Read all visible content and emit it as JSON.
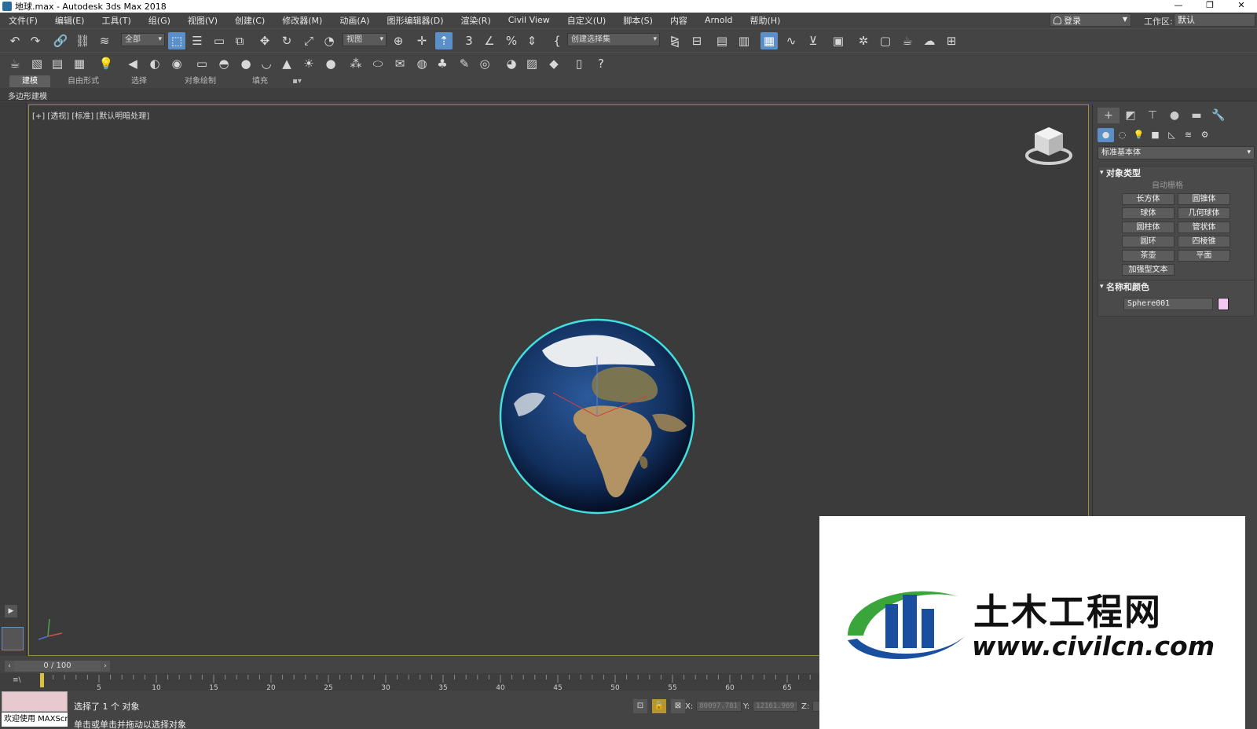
{
  "window": {
    "title": "地球.max - Autodesk 3ds Max 2018",
    "minimize": "—",
    "restore": "❐",
    "close": "✕"
  },
  "menu": [
    "文件(F)",
    "编辑(E)",
    "工具(T)",
    "组(G)",
    "视图(V)",
    "创建(C)",
    "修改器(M)",
    "动画(A)",
    "图形编辑器(D)",
    "渲染(R)",
    "Civil View",
    "自定义(U)",
    "脚本(S)",
    "内容",
    "Arnold",
    "帮助(H)"
  ],
  "account": {
    "login_label": "登录",
    "workspace_label": "工作区:",
    "workspace_value": "默认"
  },
  "toolbar": {
    "selection_filter": "全部",
    "ref_coord": "视图",
    "named_selection": "创建选择集"
  },
  "ribbon": {
    "tabs": [
      "建模",
      "自由形式",
      "选择",
      "对象绘制",
      "填充"
    ],
    "sub_label": "多边形建模"
  },
  "viewport": {
    "label": "[+] [透视] [标准] [默认明暗处理]"
  },
  "command_panel": {
    "category": "标准基本体",
    "object_type": {
      "title": "对象类型",
      "autogrid": "自动栅格",
      "buttons": [
        "长方体",
        "圆锥体",
        "球体",
        "几何球体",
        "圆柱体",
        "管状体",
        "圆环",
        "四棱锥",
        "茶壶",
        "平面",
        "加强型文本"
      ]
    },
    "name_color": {
      "title": "名称和颜色",
      "object_name": "Sphere001",
      "swatch_color": "#f0c8f0"
    }
  },
  "timeline": {
    "frame_display": "0 / 100",
    "ticks": [
      5,
      10,
      15,
      20,
      25,
      30,
      35,
      40,
      45,
      50,
      55,
      60,
      65
    ],
    "max_frame": 100
  },
  "status": {
    "welcome": "欢迎使用 MAXScr",
    "selected": "选择了 1 个 对象",
    "hint": "单击或单击并拖动以选择对象",
    "x_label": "X:",
    "x_value": "80097.781",
    "y_label": "Y:",
    "y_value": "12161.969",
    "z_label": "Z:",
    "z_value": ""
  },
  "watermark": {
    "title": "土木工程网",
    "url": "www.civilcn.com"
  },
  "colors": {
    "viewport_bg": "#3b3b3b",
    "selection_outline": "#40e0e0",
    "active_button": "#5b8fc8",
    "viewport_border": "#a08a3c"
  }
}
